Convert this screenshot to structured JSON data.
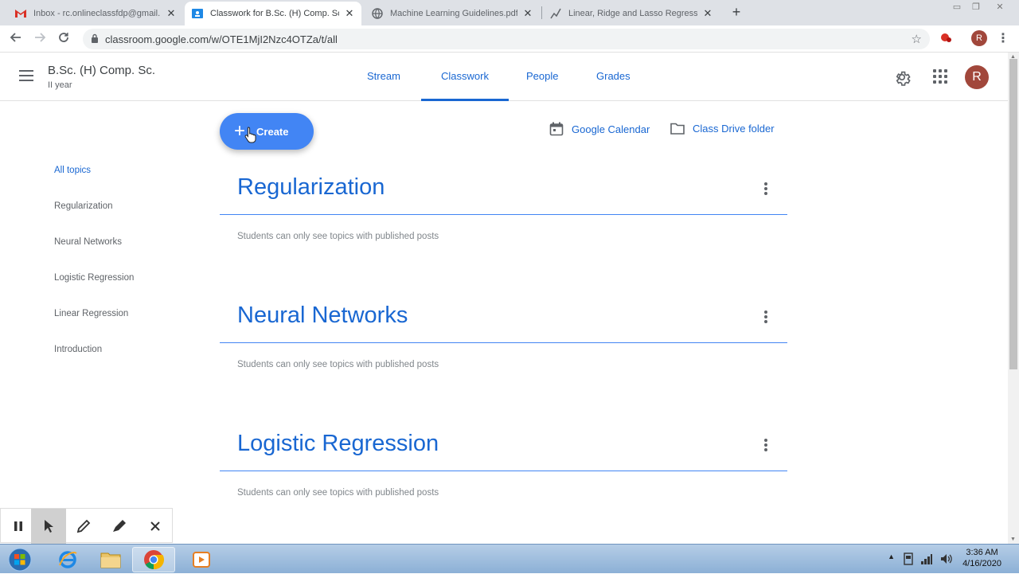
{
  "browser": {
    "tabs": [
      {
        "title": "Inbox - rc.onlineclassfdp@gmail.",
        "icon": "gmail-icon"
      },
      {
        "title": "Classwork for B.Sc. (H) Comp. Sc",
        "icon": "classroom-icon"
      },
      {
        "title": "Machine Learning Guidelines.pdf",
        "icon": "globe-icon"
      },
      {
        "title": "Linear, Ridge and Lasso Regressi",
        "icon": "chart-icon"
      }
    ],
    "active_tab": 1,
    "url": "classroom.google.com/w/OTE1MjI2Nzc4OTZa/t/all"
  },
  "header": {
    "class_name": "B.Sc. (H) Comp. Sc.",
    "class_section": "II year",
    "nav": [
      "Stream",
      "Classwork",
      "People",
      "Grades"
    ],
    "active_nav": "Classwork",
    "avatar_letter": "R"
  },
  "actions": {
    "create_label": "Create",
    "calendar_label": "Google Calendar",
    "drive_label": "Class Drive folder"
  },
  "sidebar": {
    "items": [
      "All topics",
      "Regularization",
      "Neural Networks",
      "Logistic Regression",
      "Linear Regression",
      "Introduction"
    ],
    "selected": "All topics"
  },
  "topics": [
    {
      "title": "Regularization",
      "note": "Students can only see topics with published posts"
    },
    {
      "title": "Neural Networks",
      "note": "Students can only see topics with published posts"
    },
    {
      "title": "Logistic Regression",
      "note": "Students can only see topics with published posts"
    }
  ],
  "taskbar": {
    "time": "3:36 AM",
    "date": "4/16/2020"
  },
  "colors": {
    "accent": "#1967d2",
    "create_button": "#4285f4",
    "avatar": "#a1473b",
    "tabstrip": "#dee1e6"
  }
}
